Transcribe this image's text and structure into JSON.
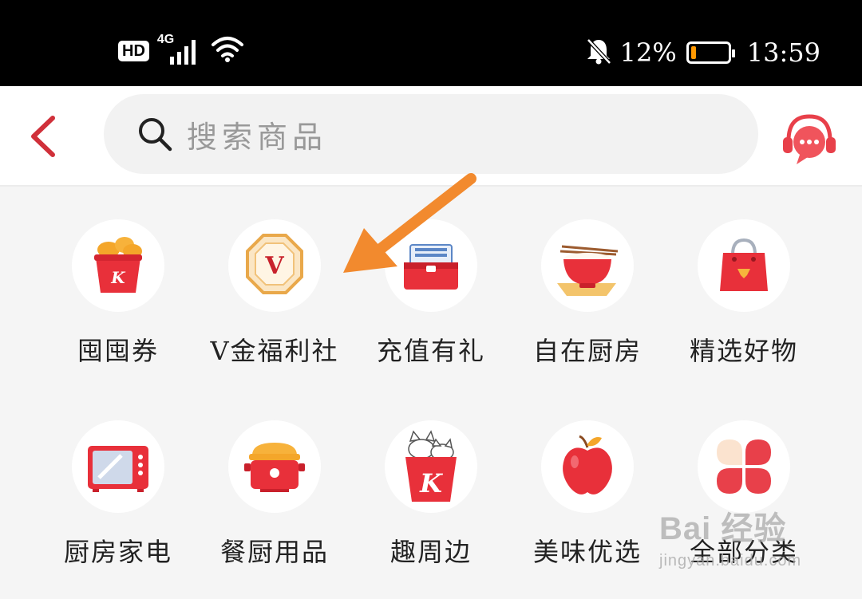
{
  "status_bar": {
    "hd_badge": "HD",
    "network": "4G",
    "battery_percent": "12%",
    "battery_level": 0.12,
    "time": "13:59",
    "icons": [
      "signal-icon",
      "wifi-icon",
      "mute-bell-icon",
      "battery-icon"
    ]
  },
  "header": {
    "back_icon": "chevron-left-icon",
    "search_placeholder": "搜索商品",
    "customer_service_icon": "headset-chat-icon",
    "accent_color": "#d0303a"
  },
  "categories": [
    {
      "label": "囤囤券",
      "icon": "kfc-bucket-icon"
    },
    {
      "label": "V金福利社",
      "icon": "v-badge-icon"
    },
    {
      "label": "充值有礼",
      "icon": "wallet-card-icon"
    },
    {
      "label": "自在厨房",
      "icon": "rice-bowl-icon"
    },
    {
      "label": "精选好物",
      "icon": "shopping-bag-icon"
    },
    {
      "label": "厨房家电",
      "icon": "microwave-icon"
    },
    {
      "label": "餐厨用品",
      "icon": "rice-cooker-icon"
    },
    {
      "label": "趣周边",
      "icon": "cat-bucket-icon"
    },
    {
      "label": "美味优选",
      "icon": "apple-icon"
    },
    {
      "label": "全部分类",
      "icon": "four-petal-icon"
    }
  ],
  "annotation": {
    "arrow_icon": "orange-arrow-icon",
    "arrow_color": "#f28a2e"
  },
  "watermark": {
    "main": "Bai 经验",
    "sub": "jingyan.baidu.com"
  }
}
